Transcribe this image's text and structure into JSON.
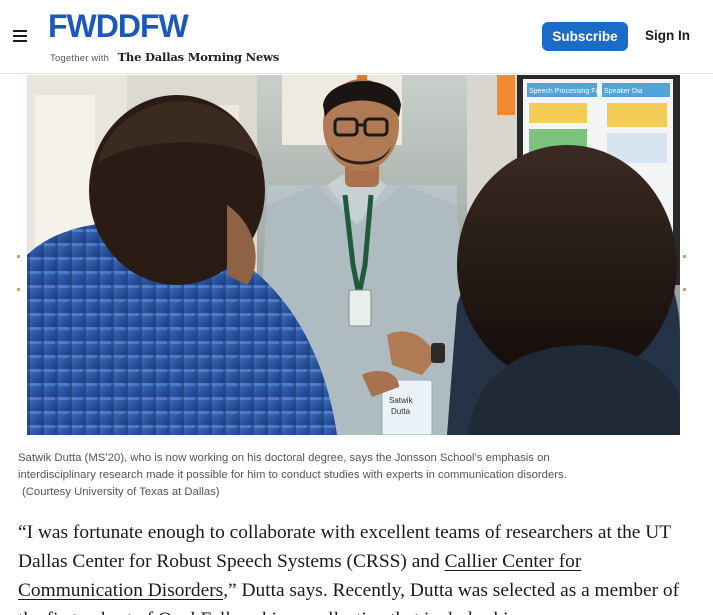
{
  "header": {
    "logo_text": "FWDDFW",
    "logo_tagline": "Together with",
    "partner_name": "The Dallas Morning News",
    "subscribe_label": "Subscribe",
    "signin_label": "Sign In"
  },
  "photo": {
    "badge_text_line1": "Satwik",
    "badge_text_line2": "Dutta",
    "poster_heading_left": "Speech Processing Fo",
    "poster_heading_right": "Speaker Dia"
  },
  "caption": {
    "line1": "Satwik Dutta (MS’20), who is now working on his doctoral degree, says the Jonsson School’s emphasis on",
    "line2": "interdisciplinary research made it possible for him to conduct studies with experts in communication disorders.",
    "line3": "(Courtesy University of Texas at Dallas)"
  },
  "article": {
    "para_start": "“I was fortunate enough to collaborate with excellent teams of researchers at the UT Dallas Center for Robust Speech Systems (CRSS) and ",
    "link_text": "Callier Center for Communication Disorders",
    "para_end": ",” Dutta says. Recently, Dutta was selected as a member of the first cohort of Opal Fellowship, a collective that includes his"
  },
  "colors": {
    "brand_blue": "#1c58b8",
    "button_blue": "#1b6bc7"
  }
}
